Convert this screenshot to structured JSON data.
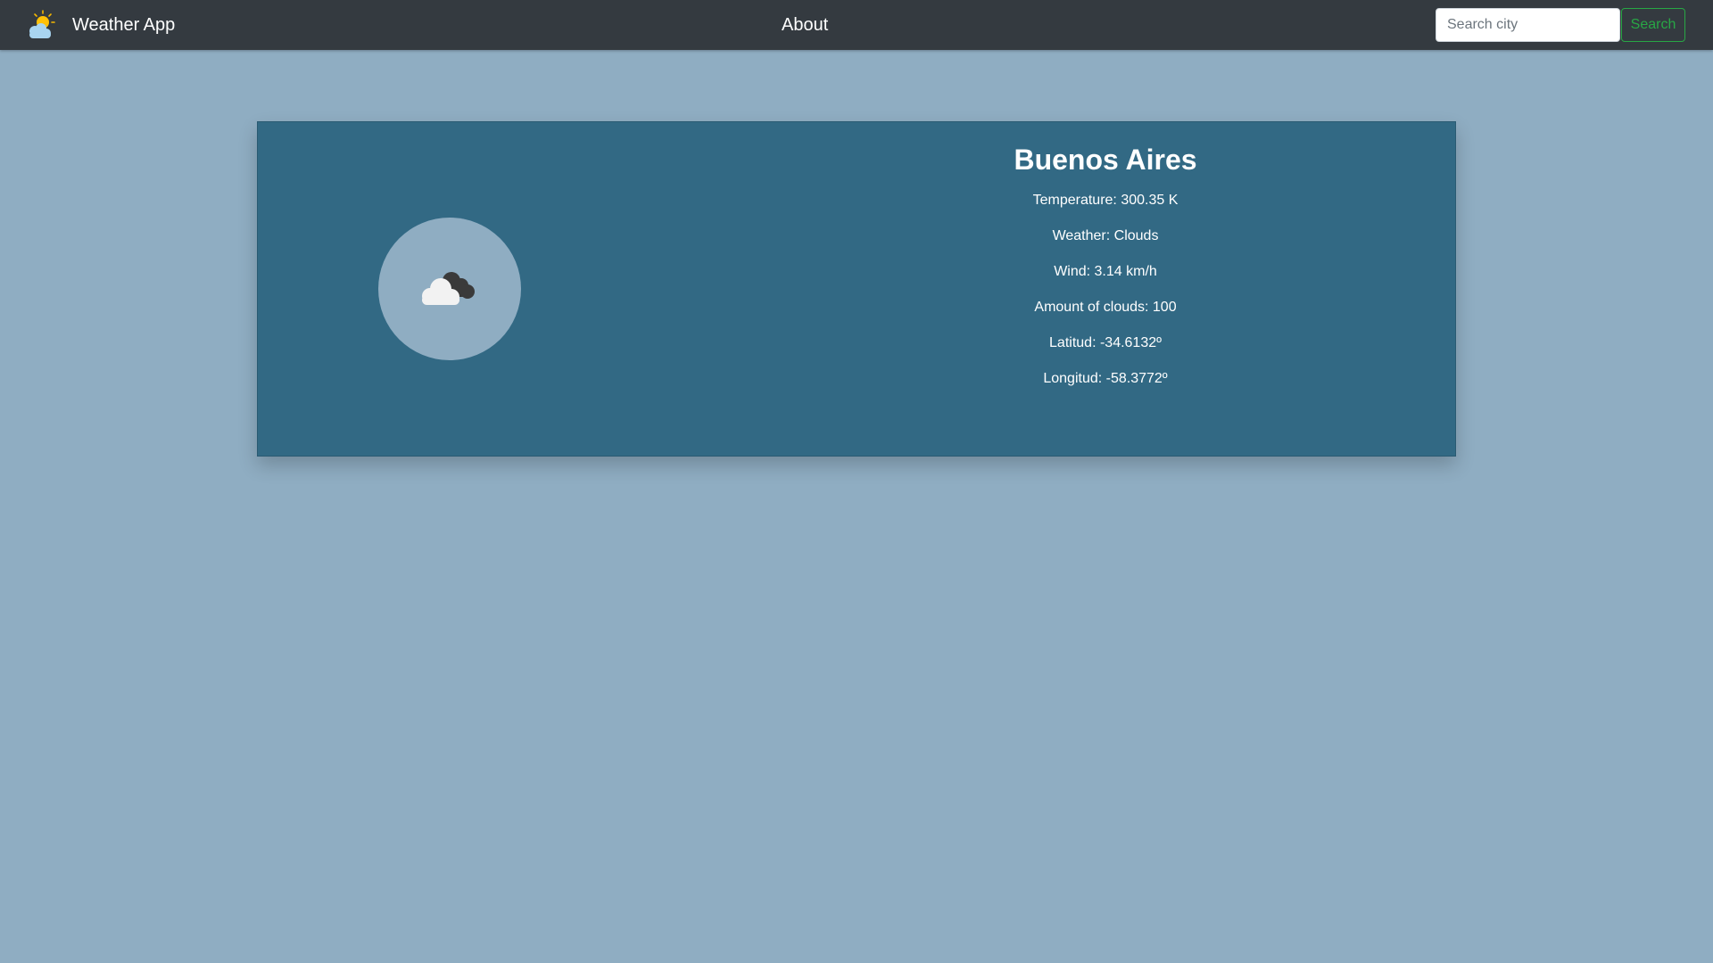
{
  "navbar": {
    "brand_icon": "sun-behind-cloud-icon",
    "brand_text": "Weather App",
    "about_link": "About",
    "search": {
      "placeholder": "Search city",
      "value": "",
      "button_label": "Search"
    }
  },
  "weather_card": {
    "icon": "clouds-icon",
    "city": "Buenos Aires",
    "lines": [
      "Temperature: 300.35 K",
      "Weather: Clouds",
      "Wind: 3.14 km/h",
      "Amount of clouds: 100",
      "Latitud: -34.6132º",
      "Longitud: -58.3772º"
    ]
  },
  "colors": {
    "page_background": "#8fadc2",
    "navbar_background": "#343a40",
    "card_background": "#326984",
    "search_button": "#28a745"
  }
}
